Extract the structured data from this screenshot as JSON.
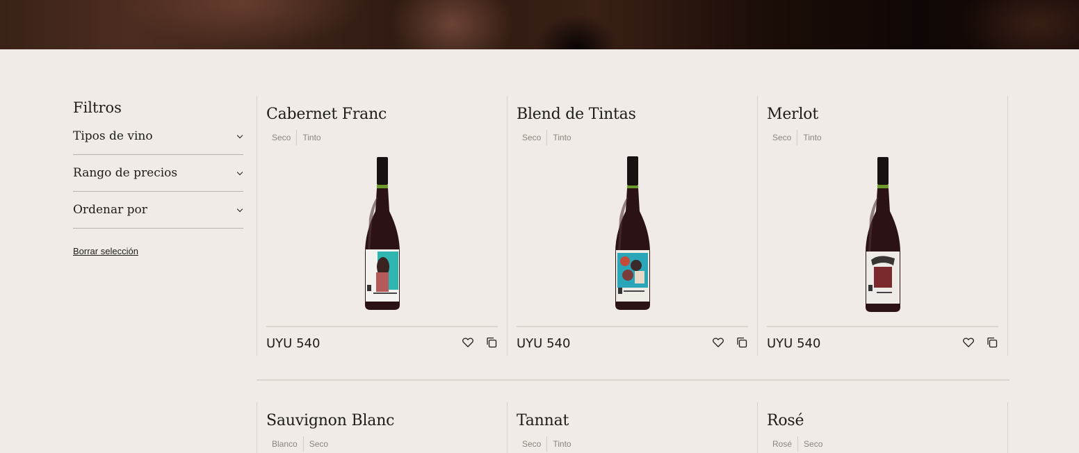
{
  "sidebar": {
    "title": "Filtros",
    "filters": [
      {
        "label": "Tipos de vino"
      },
      {
        "label": "Rango de precios"
      },
      {
        "label": "Ordenar por"
      }
    ],
    "clear_label": "Borrar selección"
  },
  "products": [
    {
      "name": "Cabernet Franc",
      "tags": [
        "Seco",
        "Tinto"
      ],
      "price": "UYU 540",
      "label_color": "#2fb6b0"
    },
    {
      "name": "Blend de Tintas",
      "tags": [
        "Seco",
        "Tinto"
      ],
      "price": "UYU 540",
      "label_color": "#2aa6b8"
    },
    {
      "name": "Merlot",
      "tags": [
        "Seco",
        "Tinto"
      ],
      "price": "UYU 540",
      "label_color": "#7a2a2a"
    },
    {
      "name": "Sauvignon Blanc",
      "tags": [
        "Blanco",
        "Seco"
      ]
    },
    {
      "name": "Tannat",
      "tags": [
        "Seco",
        "Tinto"
      ]
    },
    {
      "name": "Rosé",
      "tags": [
        "Rosé",
        "Seco"
      ]
    }
  ],
  "icons": {
    "favorite": "heart-icon",
    "compare": "copy-icon",
    "dropdown": "chevron-down-icon"
  },
  "colors": {
    "background": "#f0ebe6",
    "text": "#1e1b18",
    "tag_text": "#8b847d",
    "divider": "#ddd6cf"
  }
}
